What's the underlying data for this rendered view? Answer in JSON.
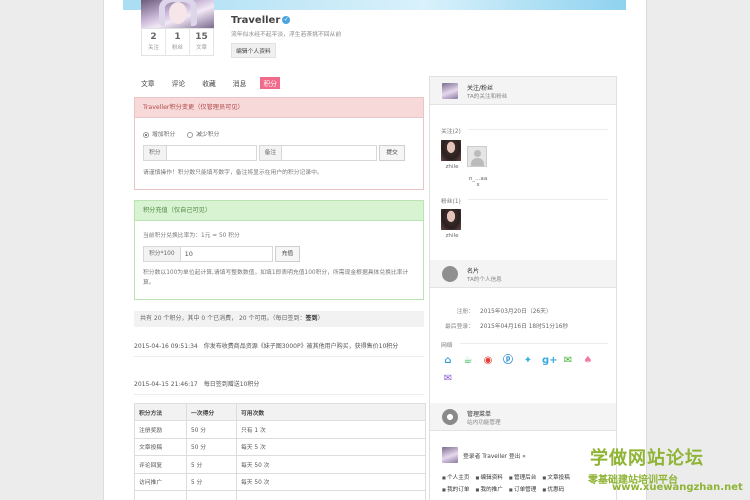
{
  "profile": {
    "name": "Traveller",
    "signature": "流年似水经不起平淡，浮生若茶挑不回从前",
    "edit_label": "编辑个人资料",
    "stats": [
      {
        "num": "2",
        "label": "关注"
      },
      {
        "num": "1",
        "label": "粉丝"
      },
      {
        "num": "15",
        "label": "文章"
      }
    ]
  },
  "tabs": [
    "文章",
    "评论",
    "收藏",
    "消息",
    "积分"
  ],
  "change_panel": {
    "title": "Traveller积分变更（仅管理员可见）",
    "radio_increase": "增加积分",
    "radio_decrease": "减少积分",
    "points_label": "积分",
    "remark_label": "备注",
    "submit_label": "提交",
    "note": "请谨慎操作！积分数只能填写数字，备注将显示在用户的积分记录中。"
  },
  "recharge_panel": {
    "title": "积分充值（仅自己可见）",
    "rate": "当前积分兑换比率为：1元 = 50 积分",
    "points_label": "积分*100",
    "points_value": "10",
    "recharge_label": "充值",
    "note": "积分数以100为单位起计算,请填写整数数值，如填1即表明充值100积分，所需现金根据具体兑换比率计算。"
  },
  "summary": {
    "text": "共有 20 个积分，其中 0 个已消费， 20 个可用。（每日签到：",
    "signin": "签到",
    "end": "）"
  },
  "logs": [
    {
      "time": "2015-04-16 09:51:34",
      "text": "你发布收费商品资源《妹子图3000P》被其他用户购买，获得售价10积分"
    },
    {
      "time": "2015-04-15 21:46:17",
      "text": "每日签到赠送10积分"
    }
  ],
  "rules_table": {
    "headers": [
      "积分方法",
      "一次得分",
      "可用次数"
    ],
    "rows": [
      [
        "注册奖励",
        "50 分",
        "只有 1 次"
      ],
      [
        "文章投稿",
        "50 分",
        "每天 5 次"
      ],
      [
        "评论回复",
        "5 分",
        "每天 50 次"
      ],
      [
        "访问推广",
        "5 分",
        "每天 50 次"
      ],
      [
        "",
        "",
        ""
      ]
    ]
  },
  "sidebar": {
    "follow_section": {
      "title": "关注/粉丝",
      "sub": "TA的关注和粉丝"
    },
    "following_label": "关注(2)",
    "following": [
      {
        "name": "zhile"
      },
      {
        "name": "n_...aa\nx"
      }
    ],
    "followers_label": "粉丝(1)",
    "followers": [
      {
        "name": "zhile"
      }
    ],
    "card_section": {
      "title": "名片",
      "sub": "TA的个人信息"
    },
    "register_label": "注册：",
    "register_value": "2015年03月20日（26天）",
    "last_login_label": "最后登录：",
    "last_login_value": "2015年04月16日 18时51分16秒",
    "network_label": "网络",
    "social_icons": [
      "home-icon",
      "coffee-icon",
      "weibo-icon",
      "p-icon",
      "twitter-icon",
      "google-plus-icon",
      "wechat-icon",
      "qq-icon",
      "mail-icon"
    ],
    "manage_section": {
      "title": "管理菜单",
      "sub": "站内功能管理"
    },
    "login_text": "登录者 Traveller 登出 »",
    "links_row1": [
      "个人主页",
      "编辑资料",
      "管理后台",
      "文章投稿"
    ],
    "links_row2": [
      "我的订单",
      "我的推广",
      "订单管理",
      "优惠码"
    ]
  },
  "watermark": {
    "line1": "学做网站论坛",
    "line2": "零基础建站培训平台",
    "line3": "www.xuewangzhan.net"
  },
  "colors": {
    "accent_pink": "#f06a8a",
    "red_panel": "#f8d9d9",
    "green_panel": "#d8f3d1",
    "watermark": "#8fb436"
  }
}
